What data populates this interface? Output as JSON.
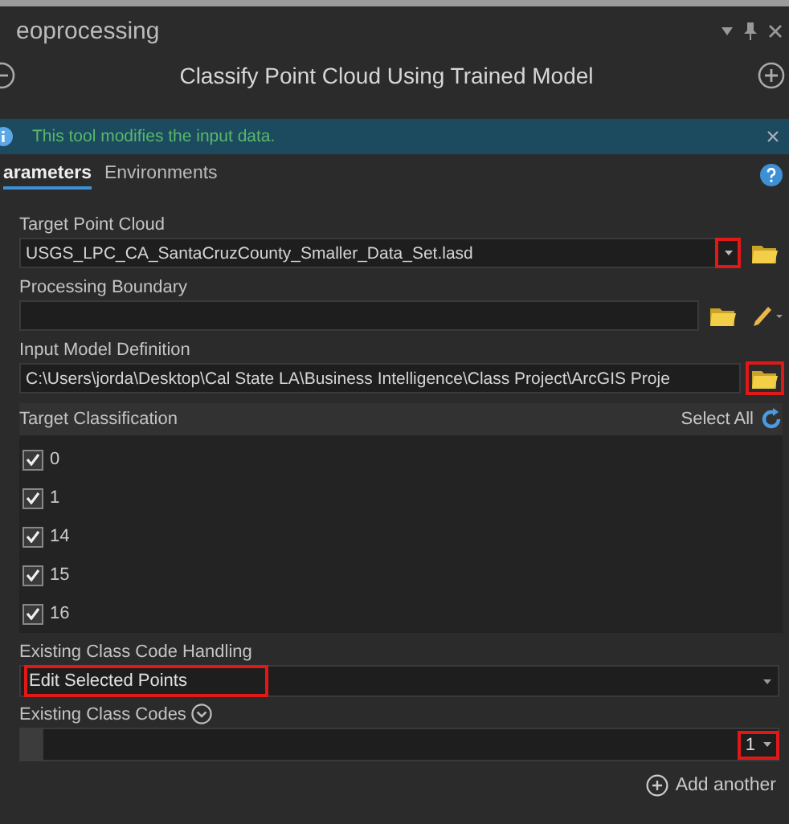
{
  "panel": {
    "title": "eoprocessing"
  },
  "tool": {
    "title": "Classify Point Cloud Using Trained Model"
  },
  "banner": {
    "message": "This tool modifies the input data."
  },
  "tabs": [
    {
      "label": "arameters",
      "selected": true
    },
    {
      "label": "Environments",
      "selected": false
    }
  ],
  "parameters": [
    {
      "kind": "file",
      "label": "Target Point Cloud",
      "value": "USGS_LPC_CA_SantaCruzCounty_Smaller_Data_Set.lasd",
      "dropdown": true,
      "dropdown_highlighted": true,
      "browse_highlighted": false
    },
    {
      "kind": "feature",
      "label": "Processing Boundary"
    },
    {
      "kind": "file",
      "label": "Input Model Definition",
      "value": "C:\\Users\\jorda\\Desktop\\Cal State LA\\Business Intelligence\\Class Project\\ArcGIS Proje",
      "dropdown": false,
      "browse_highlighted": true
    },
    {
      "kind": "checklist",
      "label": "Target Classification",
      "action": "Select All",
      "items": [
        {
          "label": "0",
          "checked": true
        },
        {
          "label": "1",
          "checked": true
        },
        {
          "label": "14",
          "checked": true
        },
        {
          "label": "15",
          "checked": true
        },
        {
          "label": "16",
          "checked": true
        }
      ]
    },
    {
      "kind": "dropdown",
      "label": "Existing Class Code Handling",
      "value": "Edit Selected Points",
      "value_highlighted": true
    },
    {
      "kind": "multivalue",
      "label": "Existing Class Codes",
      "value": "1",
      "value_highlighted": true,
      "add_label": "Add another"
    }
  ]
}
